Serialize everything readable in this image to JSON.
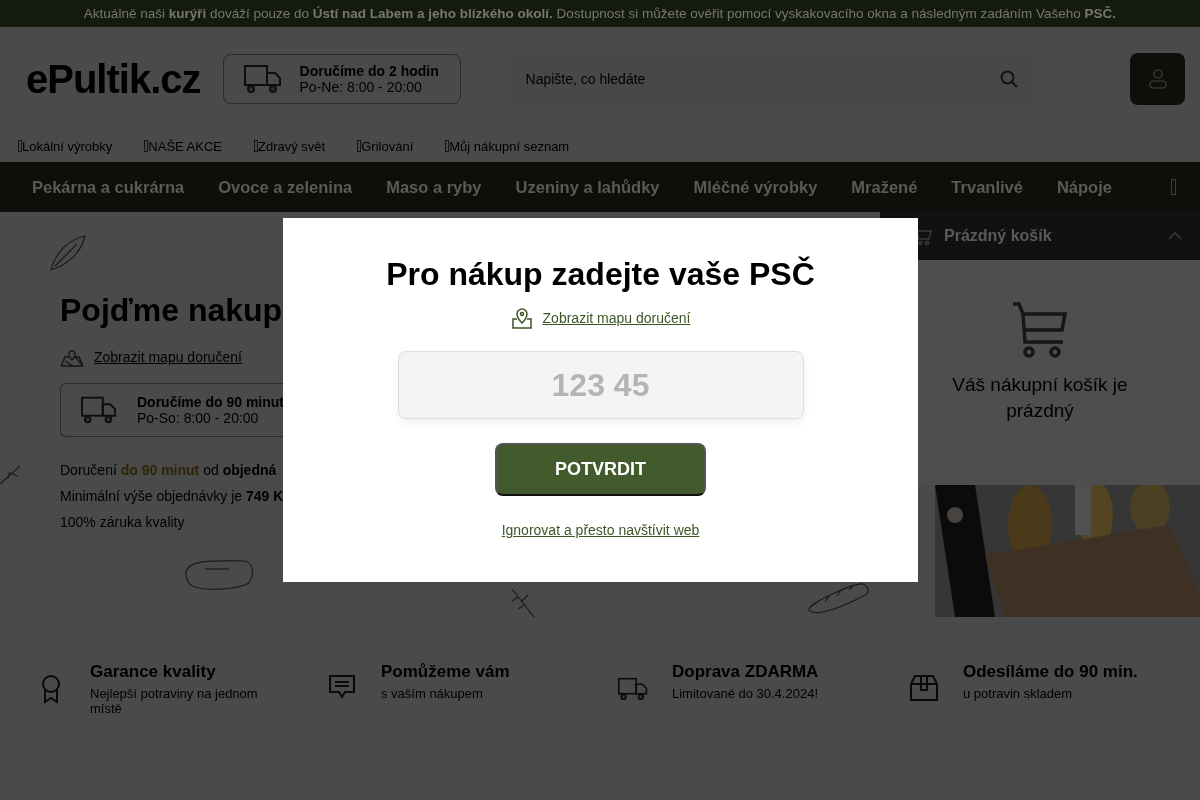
{
  "banner": {
    "text": "Aktuálně naši **kurýři** dováží pouze do **Ústí nad Labem a jeho blízkého okolí.** Dostupnost si můžete ověřit pomocí vyskakovacího okna a následným zadáním Vašeho **PSČ.**"
  },
  "header": {
    "logo": "ePultik.cz",
    "delivery": {
      "title": "Doručíme do 2 hodin",
      "hours": "Po-Ne: 8:00 - 20:00"
    },
    "search": {
      "placeholder": "Napište, co hledáte"
    }
  },
  "quick_links": [
    "Lokální výrobky",
    "NAŠE AKCE",
    "Zdravý svět",
    "Grilování",
    "Můj nákupní seznam"
  ],
  "categories": [
    "Pekárna a cukrárna",
    "Ovoce a zelenina",
    "Maso a ryby",
    "Uzeniny a lahůdky",
    "Mléčné výrobky",
    "Mražené",
    "Trvanlivé",
    "Nápoje"
  ],
  "hero": {
    "title": "Pojďme nakup",
    "map_link": "Zobrazit mapu doručení",
    "delivery": {
      "title": "Doručíme do 90 minut",
      "hours": "Po-So: 8:00 - 20:00"
    },
    "lines": [
      [
        {
          "kind": "plain",
          "text": "Doručení "
        },
        {
          "kind": "accent",
          "text": "do 90 minut"
        },
        {
          "kind": "plain",
          "text": " od "
        },
        {
          "kind": "bold",
          "text": "objedná"
        }
      ],
      [
        {
          "kind": "plain",
          "text": "Minimální výše objednávky je "
        },
        {
          "kind": "bold",
          "text": "749 K"
        }
      ],
      [
        {
          "kind": "plain",
          "text": "100% záruka kvality"
        }
      ]
    ]
  },
  "cart": {
    "title": "Prázdný košík",
    "empty_text": "Váš nákupní košík je prázdný"
  },
  "features": [
    {
      "title": "Garance kvality",
      "subtitle": "Nejlepší potraviny na jednom místě"
    },
    {
      "title": "Pomůžeme vám",
      "subtitle": "s vaším nákupem"
    },
    {
      "title": "Doprava ZDARMA",
      "subtitle": "Limitované do 30.4.2024!"
    },
    {
      "title": "Odesíláme do 90 min.",
      "subtitle": "u potravin skladem"
    }
  ],
  "modal": {
    "title": "Pro nákup zadejte vaše PSČ",
    "map_link": "Zobrazit mapu doručení",
    "zip_placeholder": "123 45",
    "confirm": "POTVRDIT",
    "ignore": "Ignorovat a přesto navštívit web"
  }
}
